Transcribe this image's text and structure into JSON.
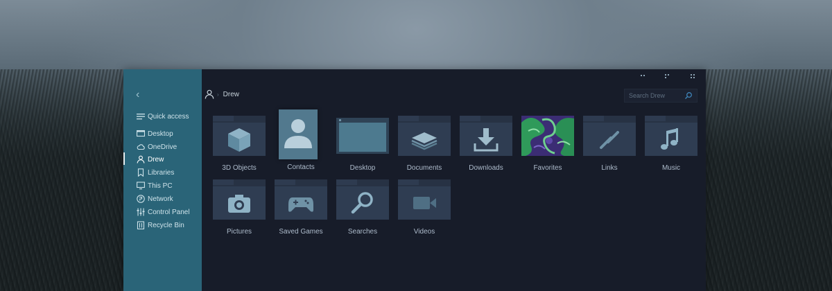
{
  "breadcrumb": {
    "location": "Drew"
  },
  "search": {
    "placeholder": "Search Drew"
  },
  "sidebar": {
    "items": [
      {
        "label": "Quick access",
        "icon": "menu-icon"
      },
      {
        "label": "Desktop",
        "icon": "desktop-icon"
      },
      {
        "label": "OneDrive",
        "icon": "cloud-icon"
      },
      {
        "label": "Drew",
        "icon": "user-icon"
      },
      {
        "label": "Libraries",
        "icon": "bookmark-icon"
      },
      {
        "label": "This PC",
        "icon": "monitor-icon"
      },
      {
        "label": "Network",
        "icon": "network-icon"
      },
      {
        "label": "Control Panel",
        "icon": "sliders-icon"
      },
      {
        "label": "Recycle Bin",
        "icon": "trash-icon"
      }
    ],
    "active": "Drew"
  },
  "folders": [
    {
      "label": "3D Objects",
      "icon": "cube-icon"
    },
    {
      "label": "Contacts",
      "icon": "contact-card-icon"
    },
    {
      "label": "Desktop",
      "icon": "desktop-window-icon"
    },
    {
      "label": "Documents",
      "icon": "layers-icon"
    },
    {
      "label": "Downloads",
      "icon": "download-icon"
    },
    {
      "label": "Favorites",
      "icon": "favorites-thumbnail"
    },
    {
      "label": "Links",
      "icon": "link-icon"
    },
    {
      "label": "Music",
      "icon": "music-note-icon"
    },
    {
      "label": "Pictures",
      "icon": "camera-icon"
    },
    {
      "label": "Saved Games",
      "icon": "gamepad-icon"
    },
    {
      "label": "Searches",
      "icon": "magnifier-icon"
    },
    {
      "label": "Videos",
      "icon": "video-camera-icon"
    }
  ],
  "colors": {
    "sidebar": "#2a6478",
    "window": "#171c29",
    "folder": "#2f3d52",
    "glyph": "#6f92a6",
    "accent": "#4a8fb0"
  }
}
